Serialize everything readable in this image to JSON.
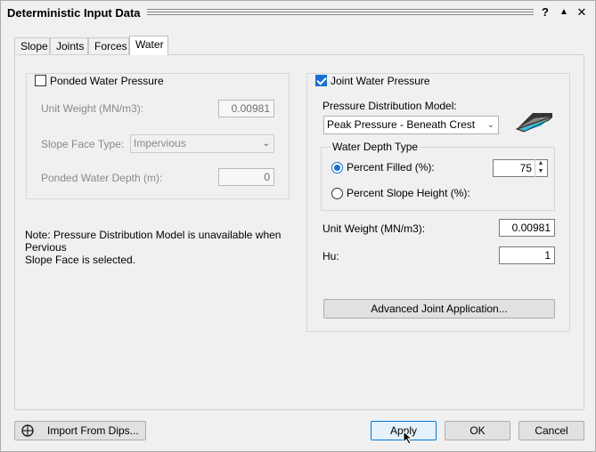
{
  "window": {
    "title": "Deterministic Input Data",
    "help_glyph": "?",
    "up_glyph": "▲",
    "close_glyph": "✕"
  },
  "tabs": [
    {
      "label": "Slope",
      "active": false
    },
    {
      "label": "Joints",
      "active": false
    },
    {
      "label": "Forces",
      "active": false
    },
    {
      "label": "Water",
      "active": true
    }
  ],
  "ponded": {
    "checkbox_label": "Ponded Water Pressure",
    "checked": false,
    "unit_weight_label": "Unit Weight (MN/m3):",
    "unit_weight_value": "0.00981",
    "slope_face_type_label": "Slope Face Type:",
    "slope_face_type_value": "Impervious",
    "ponded_depth_label": "Ponded Water Depth (m):",
    "ponded_depth_value": "0"
  },
  "note": "Note: Pressure Distribution Model is unavailable when Pervious\nSlope Face is selected.",
  "joint": {
    "checkbox_label": "Joint Water Pressure",
    "checked": true,
    "model_label": "Pressure Distribution Model:",
    "model_value": "Peak Pressure - Beneath Crest",
    "water_depth_group": "Water Depth Type",
    "percent_filled_label": "Percent Filled (%):",
    "percent_filled_value": "75",
    "percent_slope_height_label": "Percent Slope Height (%):",
    "selected_option": "percent_filled",
    "unit_weight_label": "Unit Weight (MN/m3):",
    "unit_weight_value": "0.00981",
    "hu_label": "Hu:",
    "hu_value": "1",
    "advanced_button": "Advanced Joint Application..."
  },
  "footer": {
    "import_button": "Import From Dips...",
    "apply_button": "Apply",
    "ok_button": "OK",
    "cancel_button": "Cancel"
  },
  "colors": {
    "accent": "#1a6fd1",
    "window_bg": "#f0f0f0"
  }
}
